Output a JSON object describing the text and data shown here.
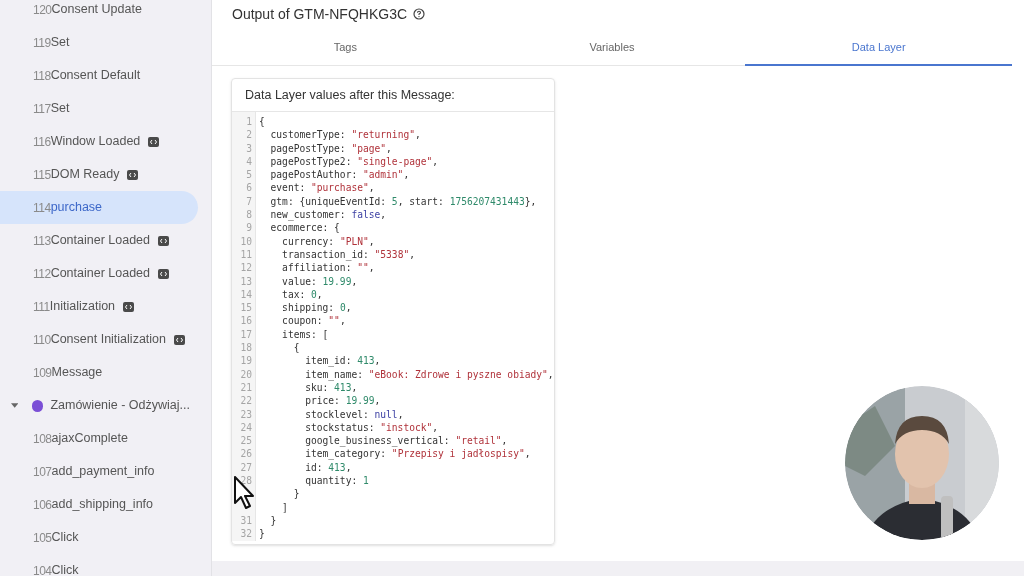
{
  "sidebar": {
    "items": [
      {
        "kind": "event",
        "number": "120",
        "label": "Consent Update",
        "tag_icon": false,
        "selected": false
      },
      {
        "kind": "event",
        "number": "119",
        "label": "Set",
        "tag_icon": false,
        "selected": false
      },
      {
        "kind": "event",
        "number": "118",
        "label": "Consent Default",
        "tag_icon": false,
        "selected": false
      },
      {
        "kind": "event",
        "number": "117",
        "label": "Set",
        "tag_icon": false,
        "selected": false
      },
      {
        "kind": "event",
        "number": "116",
        "label": "Window Loaded",
        "tag_icon": true,
        "selected": false
      },
      {
        "kind": "event",
        "number": "115",
        "label": "DOM Ready",
        "tag_icon": true,
        "selected": false
      },
      {
        "kind": "event",
        "number": "114",
        "label": "purchase",
        "tag_icon": false,
        "selected": true
      },
      {
        "kind": "event",
        "number": "113",
        "label": "Container Loaded",
        "tag_icon": true,
        "selected": false
      },
      {
        "kind": "event",
        "number": "112",
        "label": "Container Loaded",
        "tag_icon": true,
        "selected": false
      },
      {
        "kind": "event",
        "number": "111",
        "label": "Initialization",
        "tag_icon": true,
        "selected": false
      },
      {
        "kind": "event",
        "number": "110",
        "label": "Consent Initialization",
        "tag_icon": true,
        "selected": false
      },
      {
        "kind": "event",
        "number": "109",
        "label": "Message",
        "tag_icon": false,
        "selected": false
      },
      {
        "kind": "group",
        "label": "Zamówienie - Odżywiaj...",
        "color": "#7b4fd6",
        "expanded": true,
        "selected": false
      },
      {
        "kind": "event",
        "number": "108",
        "label": "ajaxComplete",
        "tag_icon": false,
        "selected": false
      },
      {
        "kind": "event",
        "number": "107",
        "label": "add_payment_info",
        "tag_icon": false,
        "selected": false
      },
      {
        "kind": "event",
        "number": "106",
        "label": "add_shipping_info",
        "tag_icon": false,
        "selected": false
      },
      {
        "kind": "event",
        "number": "105",
        "label": "Click",
        "tag_icon": false,
        "selected": false
      },
      {
        "kind": "event",
        "number": "104",
        "label": "Click",
        "tag_icon": false,
        "selected": false
      }
    ]
  },
  "header": {
    "title": "Output of GTM-NFQHKG3C"
  },
  "tabs": [
    {
      "label": "Tags",
      "selected": false
    },
    {
      "label": "Variables",
      "selected": false
    },
    {
      "label": "Data Layer",
      "selected": true
    }
  ],
  "card": {
    "title": "Data Layer values after this Message:",
    "lines": [
      {
        "number": "1",
        "tokens": [
          {
            "kind": "plain",
            "text": "{"
          }
        ]
      },
      {
        "number": "2",
        "tokens": [
          {
            "kind": "plain",
            "text": "  customerType: "
          },
          {
            "kind": "string",
            "text": "\"returning\""
          },
          {
            "kind": "plain",
            "text": ","
          }
        ]
      },
      {
        "number": "3",
        "tokens": [
          {
            "kind": "plain",
            "text": "  pagePostType: "
          },
          {
            "kind": "string",
            "text": "\"page\""
          },
          {
            "kind": "plain",
            "text": ","
          }
        ]
      },
      {
        "number": "4",
        "tokens": [
          {
            "kind": "plain",
            "text": "  pagePostType2: "
          },
          {
            "kind": "string",
            "text": "\"single-page\""
          },
          {
            "kind": "plain",
            "text": ","
          }
        ]
      },
      {
        "number": "5",
        "tokens": [
          {
            "kind": "plain",
            "text": "  pagePostAuthor: "
          },
          {
            "kind": "string",
            "text": "\"admin\""
          },
          {
            "kind": "plain",
            "text": ","
          }
        ]
      },
      {
        "number": "6",
        "tokens": [
          {
            "kind": "plain",
            "text": "  event: "
          },
          {
            "kind": "string",
            "text": "\"purchase\""
          },
          {
            "kind": "plain",
            "text": ","
          }
        ]
      },
      {
        "number": "7",
        "tokens": [
          {
            "kind": "plain",
            "text": "  gtm: {uniqueEventId: "
          },
          {
            "kind": "number",
            "text": "5"
          },
          {
            "kind": "plain",
            "text": ", start: "
          },
          {
            "kind": "number",
            "text": "1756207431443"
          },
          {
            "kind": "plain",
            "text": "},"
          }
        ]
      },
      {
        "number": "8",
        "tokens": [
          {
            "kind": "plain",
            "text": "  new_customer: "
          },
          {
            "kind": "keyword",
            "text": "false"
          },
          {
            "kind": "plain",
            "text": ","
          }
        ]
      },
      {
        "number": "9",
        "tokens": [
          {
            "kind": "plain",
            "text": "  ecommerce: {"
          }
        ]
      },
      {
        "number": "10",
        "tokens": [
          {
            "kind": "plain",
            "text": "    currency: "
          },
          {
            "kind": "string",
            "text": "\"PLN\""
          },
          {
            "kind": "plain",
            "text": ","
          }
        ]
      },
      {
        "number": "11",
        "tokens": [
          {
            "kind": "plain",
            "text": "    transaction_id: "
          },
          {
            "kind": "string",
            "text": "\"5338\""
          },
          {
            "kind": "plain",
            "text": ","
          }
        ]
      },
      {
        "number": "12",
        "tokens": [
          {
            "kind": "plain",
            "text": "    affiliation: "
          },
          {
            "kind": "string",
            "text": "\"\""
          },
          {
            "kind": "plain",
            "text": ","
          }
        ]
      },
      {
        "number": "13",
        "tokens": [
          {
            "kind": "plain",
            "text": "    value: "
          },
          {
            "kind": "number",
            "text": "19.99"
          },
          {
            "kind": "plain",
            "text": ","
          }
        ]
      },
      {
        "number": "14",
        "tokens": [
          {
            "kind": "plain",
            "text": "    tax: "
          },
          {
            "kind": "number",
            "text": "0"
          },
          {
            "kind": "plain",
            "text": ","
          }
        ]
      },
      {
        "number": "15",
        "tokens": [
          {
            "kind": "plain",
            "text": "    shipping: "
          },
          {
            "kind": "number",
            "text": "0"
          },
          {
            "kind": "plain",
            "text": ","
          }
        ]
      },
      {
        "number": "16",
        "tokens": [
          {
            "kind": "plain",
            "text": "    coupon: "
          },
          {
            "kind": "string",
            "text": "\"\""
          },
          {
            "kind": "plain",
            "text": ","
          }
        ]
      },
      {
        "number": "17",
        "tokens": [
          {
            "kind": "plain",
            "text": "    items: ["
          }
        ]
      },
      {
        "number": "18",
        "tokens": [
          {
            "kind": "plain",
            "text": "      {"
          }
        ]
      },
      {
        "number": "19",
        "tokens": [
          {
            "kind": "plain",
            "text": "        item_id: "
          },
          {
            "kind": "number",
            "text": "413"
          },
          {
            "kind": "plain",
            "text": ","
          }
        ]
      },
      {
        "number": "20",
        "tokens": [
          {
            "kind": "plain",
            "text": "        item_name: "
          },
          {
            "kind": "string",
            "text": "\"eBook: Zdrowe i pyszne obiady\""
          },
          {
            "kind": "plain",
            "text": ","
          }
        ]
      },
      {
        "number": "21",
        "tokens": [
          {
            "kind": "plain",
            "text": "        sku: "
          },
          {
            "kind": "number",
            "text": "413"
          },
          {
            "kind": "plain",
            "text": ","
          }
        ]
      },
      {
        "number": "22",
        "tokens": [
          {
            "kind": "plain",
            "text": "        price: "
          },
          {
            "kind": "number",
            "text": "19.99"
          },
          {
            "kind": "plain",
            "text": ","
          }
        ]
      },
      {
        "number": "23",
        "tokens": [
          {
            "kind": "plain",
            "text": "        stocklevel: "
          },
          {
            "kind": "keyword",
            "text": "null"
          },
          {
            "kind": "plain",
            "text": ","
          }
        ]
      },
      {
        "number": "24",
        "tokens": [
          {
            "kind": "plain",
            "text": "        stockstatus: "
          },
          {
            "kind": "string",
            "text": "\"instock\""
          },
          {
            "kind": "plain",
            "text": ","
          }
        ]
      },
      {
        "number": "25",
        "tokens": [
          {
            "kind": "plain",
            "text": "        google_business_vertical: "
          },
          {
            "kind": "string",
            "text": "\"retail\""
          },
          {
            "kind": "plain",
            "text": ","
          }
        ]
      },
      {
        "number": "26",
        "tokens": [
          {
            "kind": "plain",
            "text": "        item_category: "
          },
          {
            "kind": "string",
            "text": "\"Przepisy i jadłospisy\""
          },
          {
            "kind": "plain",
            "text": ","
          }
        ]
      },
      {
        "number": "27",
        "tokens": [
          {
            "kind": "plain",
            "text": "        id: "
          },
          {
            "kind": "number",
            "text": "413"
          },
          {
            "kind": "plain",
            "text": ","
          }
        ]
      },
      {
        "number": "28",
        "tokens": [
          {
            "kind": "plain",
            "text": "        quantity: "
          },
          {
            "kind": "number",
            "text": "1"
          }
        ]
      },
      {
        "tokens": [
          {
            "kind": "plain",
            "text": "      }"
          }
        ]
      },
      {
        "tokens": [
          {
            "kind": "plain",
            "text": "    ]"
          }
        ]
      },
      {
        "number": "31",
        "tokens": [
          {
            "kind": "plain",
            "text": "  }"
          }
        ]
      },
      {
        "number": "32",
        "tokens": [
          {
            "kind": "plain",
            "text": "}"
          }
        ]
      }
    ]
  }
}
